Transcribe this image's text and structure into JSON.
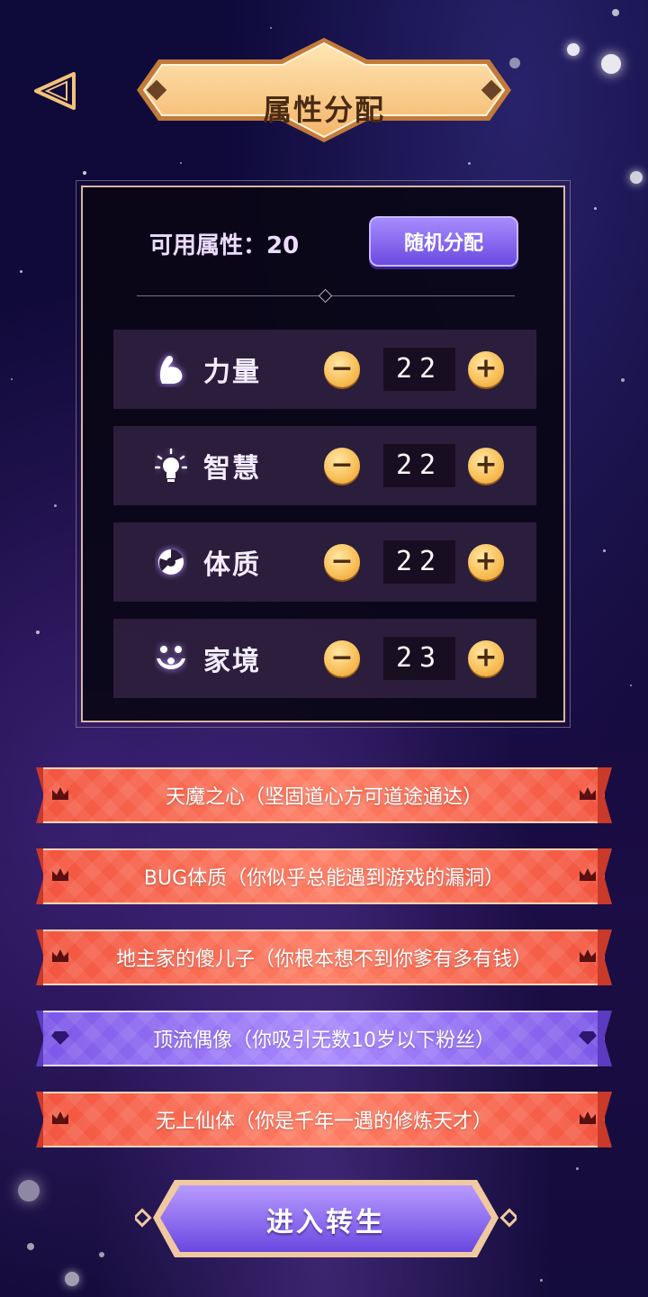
{
  "title": "属性分配",
  "available": {
    "label": "可用属性：20"
  },
  "random_button": "随机分配",
  "stats": [
    {
      "label": "力量",
      "value": "22",
      "icon": "muscle-icon"
    },
    {
      "label": "智慧",
      "value": "22",
      "icon": "lightbulb-icon"
    },
    {
      "label": "体质",
      "value": "22",
      "icon": "body-icon"
    },
    {
      "label": "家境",
      "value": "23",
      "icon": "family-icon"
    }
  ],
  "talents": [
    {
      "text": "天魔之心（坚固道心方可道途通达）",
      "color": "red",
      "icon": "crown-icon"
    },
    {
      "text": "BUG体质（你似乎总能遇到游戏的漏洞）",
      "color": "red",
      "icon": "crown-icon"
    },
    {
      "text": "地主家的傻儿子（你根本想不到你爹有多有钱）",
      "color": "red",
      "icon": "crown-icon"
    },
    {
      "text": "顶流偶像（你吸引无数10岁以下粉丝）",
      "color": "purple",
      "icon": "diamond-icon"
    },
    {
      "text": "无上仙体（你是千年一遇的修炼天才）",
      "color": "red",
      "icon": "crown-icon"
    }
  ],
  "enter_button": "进入转生",
  "colors": {
    "gold": "#f7bd55",
    "red_ribbon": "#f2553f",
    "purple_ribbon": "#7d57e8",
    "panel_border": "#d8b7a0"
  }
}
